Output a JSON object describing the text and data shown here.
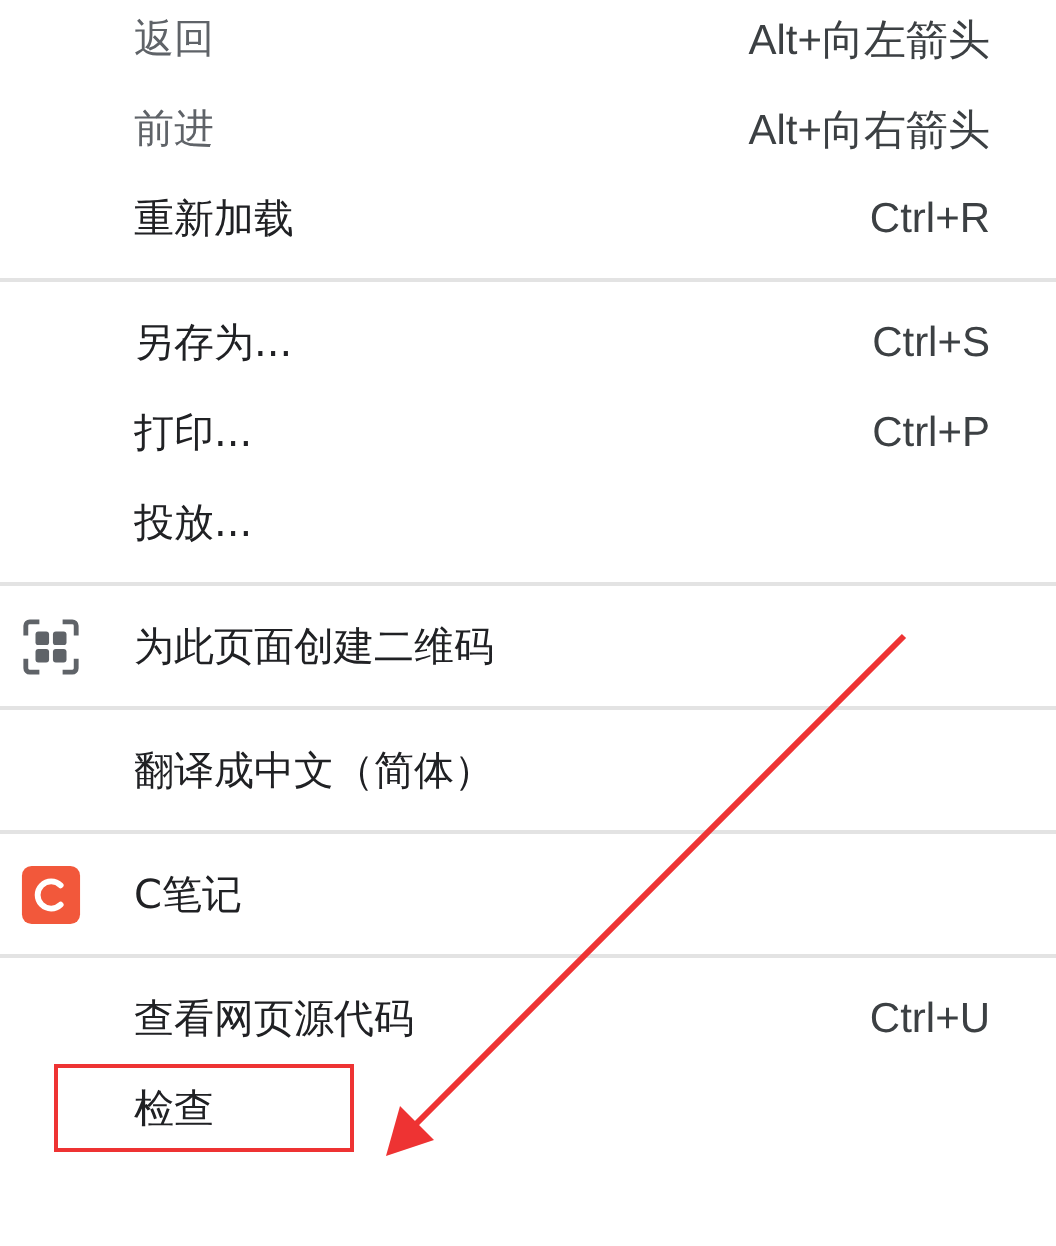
{
  "menu": {
    "groups": [
      {
        "items": [
          {
            "label": "返回",
            "shortcut": "Alt+向左箭头",
            "disabled": true,
            "highlighted": false
          },
          {
            "label": "前进",
            "shortcut": "Alt+向右箭头",
            "disabled": true,
            "highlighted": false
          },
          {
            "label": "重新加载",
            "shortcut": "Ctrl+R",
            "disabled": false,
            "highlighted": false
          }
        ]
      },
      {
        "items": [
          {
            "label": "另存为...",
            "shortcut": "Ctrl+S",
            "disabled": false,
            "highlighted": false
          },
          {
            "label": "打印...",
            "shortcut": "Ctrl+P",
            "disabled": false,
            "highlighted": false
          },
          {
            "label": "投放...",
            "disabled": false,
            "highlighted": false
          }
        ]
      },
      {
        "items": [
          {
            "label": "为此页面创建二维码",
            "kind": "qr",
            "disabled": false,
            "highlighted": false
          }
        ]
      },
      {
        "items": [
          {
            "label": "翻译成中文（简体）",
            "disabled": false,
            "highlighted": false
          }
        ]
      },
      {
        "items": [
          {
            "label": "C笔记",
            "kind": "logo",
            "disabled": false,
            "highlighted": false
          }
        ]
      },
      {
        "items": [
          {
            "label": "查看网页源代码",
            "shortcut": "Ctrl+U",
            "disabled": false,
            "highlighted": false
          },
          {
            "label": "检查",
            "disabled": false,
            "highlighted": true
          }
        ]
      }
    ]
  }
}
